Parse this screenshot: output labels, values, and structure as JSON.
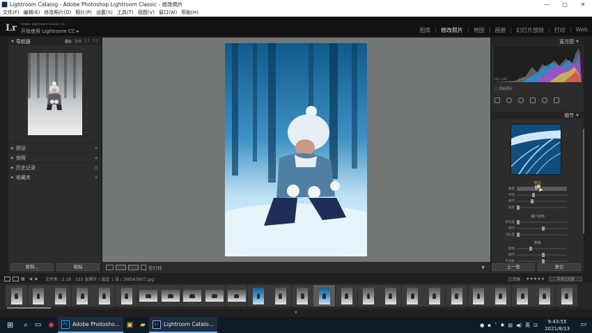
{
  "window": {
    "title": "Lightroom Catalog - Adobe Photoshop Lightroom Classic - 修改照片",
    "minimize": "—",
    "maximize": "□",
    "close": "✕"
  },
  "menu": [
    "文件(F)",
    "编辑(E)",
    "修改照片(D)",
    "照片(P)",
    "设置(S)",
    "工具(T)",
    "视图(V)",
    "窗口(W)",
    "帮助(H)"
  ],
  "identity": {
    "logo": "Lr",
    "small": "Adobe Lightroom Classic CC",
    "big": "开始使用 Lightroom CC",
    "arrow": "▸"
  },
  "modules": {
    "items": [
      "图库",
      "修改照片",
      "地图",
      "画册",
      "幻灯片放映",
      "打印",
      "Web"
    ],
    "active": "修改照片"
  },
  "left_panel": {
    "navigator": "导航器",
    "zoom": [
      "适合",
      "填满",
      "1:1",
      "2:1"
    ],
    "sections": [
      "预设",
      "快照",
      "历史记录",
      "收藏夹"
    ],
    "copy_button": "复制...",
    "paste_button": "粘贴"
  },
  "toolbar": {
    "softproof_label": "软打样"
  },
  "right_panel": {
    "histogram": "直方图",
    "histo_info": [
      "ISO 100",
      "135 mm",
      "f / 2.0",
      "1/1250 秒"
    ],
    "original_photo": "原始照片",
    "detail": "细节",
    "sharpen": "锐化",
    "sharpen_sliders": [
      {
        "label": "数量",
        "value": "",
        "pos": 0.36
      },
      {
        "label": "半径",
        "value": "",
        "pos": 0.3
      },
      {
        "label": "细节",
        "value": "",
        "pos": 0.28
      },
      {
        "label": "蒙版",
        "value": "",
        "pos": 0.0
      }
    ],
    "noise": "减少杂色",
    "noise_sliders": [
      {
        "label": "明亮度",
        "value": "",
        "pos": 0.0
      },
      {
        "label": "细节",
        "value": "",
        "pos": 0.5
      },
      {
        "label": "对比度",
        "value": "",
        "pos": 0.0
      }
    ],
    "color": "颜色",
    "color_sliders": [
      {
        "label": "颜色",
        "value": "",
        "pos": 0.25
      },
      {
        "label": "细节",
        "value": "",
        "pos": 0.5
      },
      {
        "label": "平滑度",
        "value": "",
        "pos": 0.5
      }
    ],
    "prev_button": "上一张",
    "reset_button": "复位"
  },
  "filmstrip": {
    "folder_info": "文件夹 : 2.16",
    "count_info": "333 张照片 / 选定 1 张 / 3W5A3807.jpg",
    "filter_label": "过滤器 :",
    "rating": "★★★★★",
    "filter_select": "关闭过滤器"
  },
  "taskbar": {
    "photoshop": "Adobe Photosho...",
    "lightroom": "Lightroom Catalo...",
    "lang": "英",
    "time": "9:43:55",
    "date": "2021/8/13"
  },
  "colors": {
    "panel": "#2c2c2c",
    "center": "#737775",
    "accent": "#e8d53a"
  }
}
